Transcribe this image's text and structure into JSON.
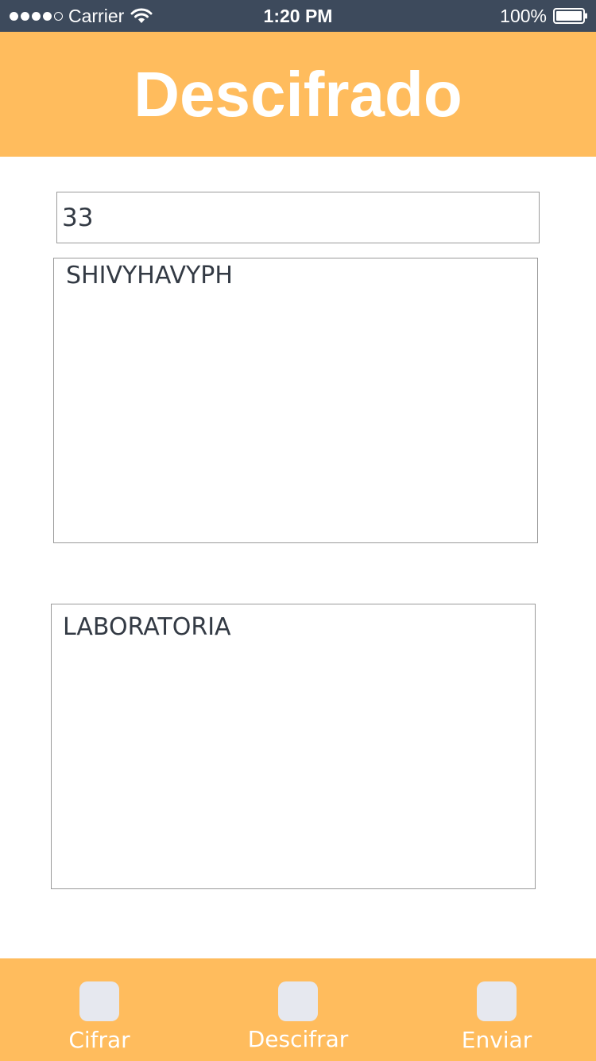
{
  "status_bar": {
    "carrier": "Carrier",
    "time": "1:20 PM",
    "battery": "100%"
  },
  "header": {
    "title": "Descifrado"
  },
  "form": {
    "key_value": "33",
    "cipher_text": "SHIVYHAVYPH",
    "plain_text": "LABORATORIA"
  },
  "tabbar": {
    "items": [
      {
        "label": "Cifrar",
        "icon": "cifrar-icon"
      },
      {
        "label": "Descifrar",
        "icon": "descifrar-icon"
      },
      {
        "label": "Enviar",
        "icon": "enviar-icon"
      }
    ]
  },
  "colors": {
    "accent": "#ffbc5d",
    "status_bar": "#3d4a5c",
    "text": "#333a44",
    "tab_icon": "#e6e8ef"
  }
}
